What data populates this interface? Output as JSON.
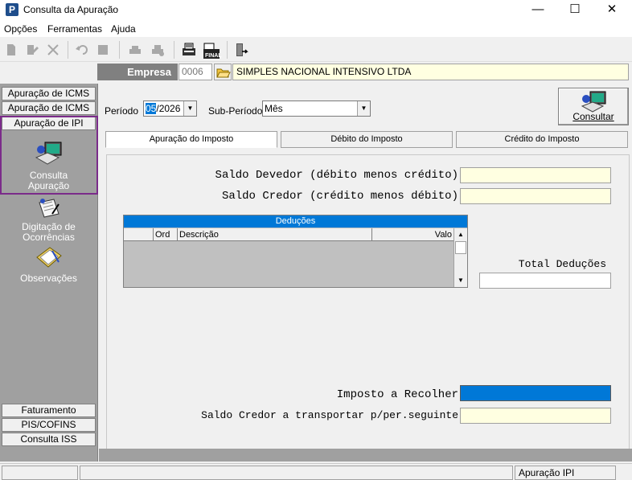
{
  "window": {
    "title": "Consulta da Apuração",
    "app_icon_letter": "P"
  },
  "menu": {
    "items": [
      "Opções",
      "Ferramentas",
      "Ajuda"
    ]
  },
  "toolbar": {
    "print_label": "",
    "final_label": "FINAL"
  },
  "empresa": {
    "label": "Empresa",
    "code": "0006",
    "name": "SIMPLES NACIONAL INTENSIVO LTDA"
  },
  "sidebar": {
    "top_tabs": [
      "Apuração de ICMS",
      "Apuração de ICMS ST",
      "Apuração de IPI"
    ],
    "items": [
      "Consulta Apuração",
      "Digitação de Ocorrências",
      "Observações"
    ],
    "bottom_tabs": [
      "Faturamento",
      "PIS/COFINS",
      "Consulta ISS"
    ]
  },
  "filters": {
    "periodo_label": "Período",
    "periodo_month": "05",
    "periodo_rest": "/2026",
    "subperiodo_label": "Sub-Período",
    "subperiodo_value": "Mês"
  },
  "consultar_label": "Consultar",
  "tabs": [
    "Apuração do Imposto",
    "Débito do Imposto",
    "Crédito do Imposto"
  ],
  "panel": {
    "saldo_devedor_label": "Saldo Devedor (débito menos crédito)",
    "saldo_credor_label": "Saldo Credor (crédito menos débito)",
    "deducoes_title": "Deduções",
    "columns": [
      "",
      "Ord",
      "Descrição",
      "Valo"
    ],
    "total_deducoes_label": "Total Deduções",
    "imposto_label": "Imposto a Recolher",
    "saldo_transportar_label": "Saldo Credor a transportar p/per.seguinte"
  },
  "status": {
    "panel_right": "Apuração IPI"
  },
  "colors": {
    "accent": "#0078d7",
    "selected_border": "#7b2b8a",
    "field_yellow": "#ffffe1",
    "empresa_bg": "#808080"
  }
}
